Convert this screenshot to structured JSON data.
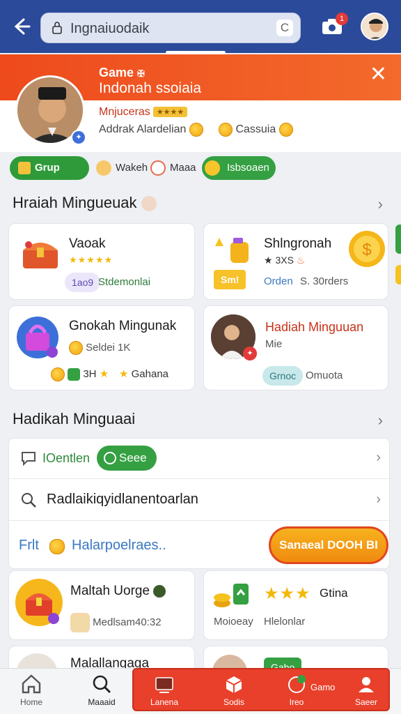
{
  "topbar": {
    "search_text": "Ingnaiuodaik",
    "reload_glyph": "C",
    "notification_count": "1",
    "colors": {
      "bar": "#2b4a9a",
      "badge": "#e23a3a"
    }
  },
  "profile": {
    "game_label": "Game",
    "game_subtitle": "Indonah ssoiaia",
    "name": "Mnjuceras",
    "name_tag": "★★★★",
    "line1": "Addrak Alardelian",
    "line2": "Cassuia",
    "colors": {
      "banner": "#ee4a1c"
    }
  },
  "chips": {
    "grup": "Grup",
    "wakeh": "Wakeh",
    "maaa": "Maaa",
    "green": "Isbsoaen"
  },
  "section1": {
    "title": "Hraiah Mingueuak"
  },
  "cards1": [
    {
      "title": "Vaoak",
      "sub_pill": "1ao9",
      "sub_text": "Stdemonlai",
      "rating": "★★★★★"
    },
    {
      "title": "Shlngronah",
      "rating_text": "★ 3XS",
      "pill": "Sm!",
      "sub_text_a": "Orden",
      "sub_text_b": "S. 30rders"
    },
    {
      "title": "Gnokah Mingunak",
      "line2": "Seldei 1K",
      "count": "3H",
      "extra": "Gahana"
    },
    {
      "title": "Hadiah Minguuan",
      "line2": "Mie",
      "pill": "Grnoc",
      "sub_text": "Omuota"
    }
  ],
  "section2": {
    "title": "Hadikah Minguaai"
  },
  "list": {
    "row1_label": "IOentlen",
    "row1_pill": "Seee",
    "row2_label": "Radlaikiqyidlanentoarlan",
    "row3_prefix": "Frlt",
    "row3_label": "Halarpoelraes..",
    "button_label": "Sanaeal DOOH BI"
  },
  "cards2": [
    {
      "title": "Maltah Uorge",
      "line2": "Medlsam40:32"
    },
    {
      "title": "Gtina",
      "line2a": "Moioeay",
      "line2b": "Hlelonlar"
    },
    {
      "title": "Malallangaga"
    },
    {
      "pill": "Gabo"
    }
  ],
  "bottom_nav": {
    "items": [
      "Home",
      "Maaaid",
      "Lanena",
      "Sodis",
      "Ireo",
      "Saeer"
    ],
    "overlay_label": "Gamo",
    "colors": {
      "active_bg": "#e8402a"
    }
  }
}
